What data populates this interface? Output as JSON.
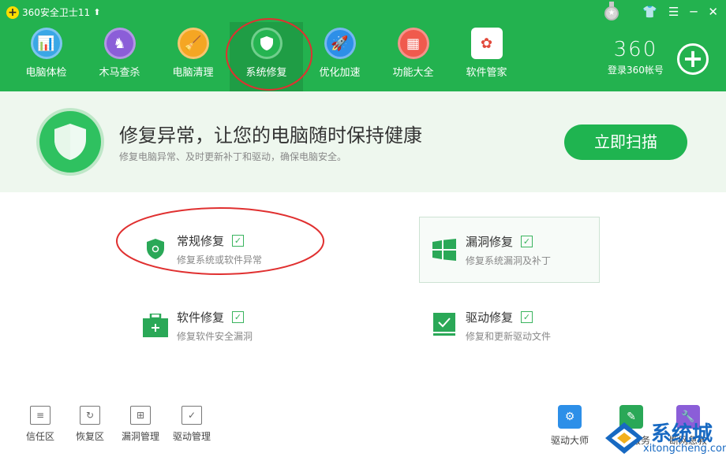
{
  "app": {
    "title": "360安全卫士11",
    "up_arrow": "⬆"
  },
  "window_controls": [
    "👕",
    "☰",
    "─",
    "✕"
  ],
  "medal_icon": "medal-icon",
  "nav": [
    {
      "label": "电脑体检",
      "icon": "monitor-icon",
      "color": "#3aa7e6",
      "glyph": "📊"
    },
    {
      "label": "木马查杀",
      "icon": "horse-icon",
      "color": "#8b5ed8",
      "glyph": "♞"
    },
    {
      "label": "电脑清理",
      "icon": "broom-icon",
      "color": "#f5a623",
      "glyph": "🧹"
    },
    {
      "label": "系统修复",
      "icon": "shield-icon",
      "color": "#25b451",
      "glyph": "🛡"
    },
    {
      "label": "优化加速",
      "icon": "rocket-icon",
      "color": "#2d8fe8",
      "glyph": "🚀"
    },
    {
      "label": "功能大全",
      "icon": "grid-icon",
      "color": "#f05a4d",
      "glyph": "▦"
    },
    {
      "label": "软件管家",
      "icon": "flower-icon",
      "color": "#ffffff",
      "glyph": "✿"
    }
  ],
  "account": {
    "brand": "360",
    "login": "登录360帐号",
    "plus": "+"
  },
  "banner": {
    "title": "修复异常，让您的电脑随时保持健康",
    "subtitle": "修复电脑异常、及时更新补丁和驱动，确保电脑安全。",
    "scan_button": "立即扫描"
  },
  "repair_items": [
    {
      "title": "常规修复",
      "desc": "修复系统或软件异常",
      "checked": "✓"
    },
    {
      "title": "漏洞修复",
      "desc": "修复系统漏洞及补丁",
      "checked": "✓"
    },
    {
      "title": "软件修复",
      "desc": "修复软件安全漏洞",
      "checked": "✓"
    },
    {
      "title": "驱动修复",
      "desc": "修复和更新驱动文件",
      "checked": "✓"
    }
  ],
  "bottom_tools": [
    "信任区",
    "恢复区",
    "漏洞管理",
    "驱动管理"
  ],
  "right_tools": [
    "驱动大师",
    "人工服务",
    "断网急救"
  ],
  "watermark": {
    "brand": "系统城",
    "url": "xitongcheng.com"
  },
  "colors": {
    "brand_green": "#23b24f",
    "active_green": "#1f9d45",
    "accent_red": "#e03030"
  }
}
